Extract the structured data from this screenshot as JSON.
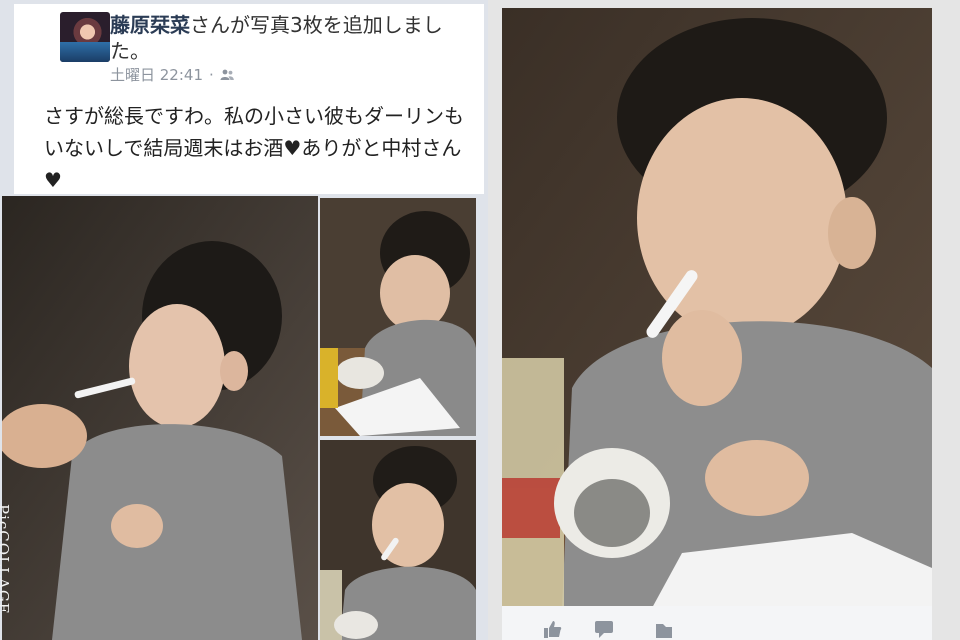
{
  "post": {
    "author": "藤原栞菜",
    "action": "さんが写真3枚を追加しました。",
    "timestamp": "土曜日 22:41",
    "audience_icon": "friends-icon",
    "body": "さすが総長ですわ。私の小さい彼もダーリンもいないしで結局週末はお酒♥ありがと中村さん♥"
  },
  "photos": {
    "count": 3,
    "watermark": "PicCOLLAGE"
  },
  "actions": {
    "icons": [
      "like-icon",
      "comment-icon",
      "share-icon"
    ]
  },
  "colors": {
    "page_background": "#dfe3ea",
    "author_name": "#2b3c55",
    "meta_text": "#8d949e"
  }
}
